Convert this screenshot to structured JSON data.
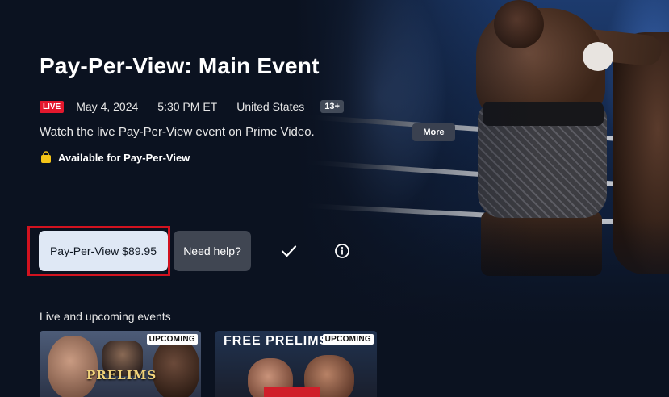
{
  "event": {
    "title": "Pay-Per-View: Main Event",
    "live_label": "LIVE",
    "date": "May 4, 2024",
    "time": "5:30 PM ET",
    "region": "United States",
    "rating": "13+",
    "description": "Watch the live Pay-Per-View event on Prime Video.",
    "more_label": "More",
    "availability": "Available for Pay-Per-View"
  },
  "actions": {
    "buy_label": "Pay-Per-View $89.95",
    "help_label": "Need help?"
  },
  "icons": {
    "availability": "shopping-bag-icon",
    "watchlist": "checkmark-icon",
    "info": "info-icon"
  },
  "colors": {
    "live": "#e3182d",
    "buy_button": "#dfe8f5",
    "availability_icon": "#f5c518",
    "highlight_outline": "#d2121f"
  },
  "events_section": {
    "title": "Live and upcoming events",
    "cards": [
      {
        "art_text": "PRELIMS",
        "badge": "UPCOMING"
      },
      {
        "art_text": "FREE PRELIMS",
        "badge": "UPCOMING"
      }
    ]
  }
}
